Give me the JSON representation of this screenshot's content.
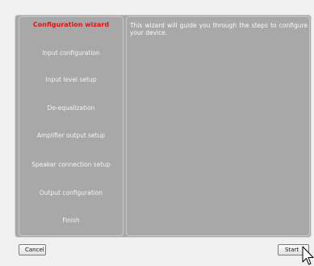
{
  "wizard": {
    "steps": [
      {
        "label": "Configuration wizard",
        "active": true
      },
      {
        "label": "Input configuration",
        "active": false
      },
      {
        "label": "Input level setup",
        "active": false
      },
      {
        "label": "De-equalization",
        "active": false
      },
      {
        "label": "Amplifier output setup",
        "active": false
      },
      {
        "label": "Speaker connection setup",
        "active": false
      },
      {
        "label": "Output configuration",
        "active": false
      },
      {
        "label": "Finish",
        "active": false
      }
    ],
    "description": "This wizard will guide you through the steps to configure your device."
  },
  "buttons": {
    "cancel_label": "Cancel",
    "start_label": "Start"
  },
  "colors": {
    "active_step": "#e81010",
    "inactive_step": "#f4f4f4",
    "panel": "#a8a8a8"
  },
  "icons": {
    "cursor": "arrow-pointer-icon"
  }
}
